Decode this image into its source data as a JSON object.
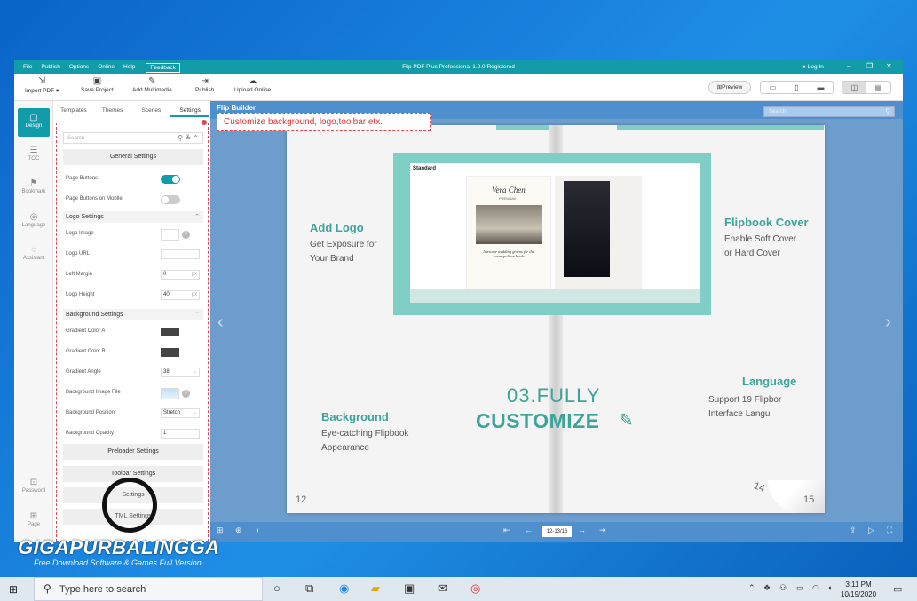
{
  "app": {
    "title": "Flip PDF Plus Professional 1.2.0 Registered",
    "menu": [
      "File",
      "Publish",
      "Options",
      "Online",
      "Help"
    ],
    "feedback": "Feedback",
    "login": "Log In"
  },
  "toolbar": {
    "import": "Import PDF ▾",
    "save": "Save Project",
    "multimedia": "Add Multimedia",
    "publish": "Publish",
    "upload": "Upload Online",
    "preview": "Preview"
  },
  "rail": {
    "design": "Design",
    "toc": "TOC",
    "bookmark": "Bookmark",
    "language": "Language",
    "assistant": "Assistant",
    "password": "Password",
    "page": "Page"
  },
  "panel": {
    "tabs": [
      "Templates",
      "Themes",
      "Scenes",
      "Settings"
    ],
    "search_placeholder": "Search",
    "general": "General Settings",
    "page_buttons": "Page Buttons",
    "page_buttons_mobile": "Page Buttons on Mobile",
    "page_buttons_on": 1,
    "page_buttons_mobile_on": 0,
    "logo_settings": "Logo Settings",
    "logo_image": "Logo Image",
    "logo_url": "Logo URL",
    "left_margin": "Left Margin",
    "left_margin_val": "0",
    "logo_height": "Logo Height",
    "logo_height_val": "40",
    "unit": "px",
    "bg_settings": "Background Settings",
    "grad_a": "Gradient Color A",
    "grad_b": "Gradient Color B",
    "grad_angle": "Gradient Angle",
    "grad_angle_val": "38",
    "bg_image": "Background Image File",
    "bg_position": "Background Position",
    "bg_position_val": "Stretch",
    "bg_opacity": "Background Opacity",
    "bg_opacity_val": "1",
    "preloader": "Preloader Settings",
    "toolbar_settings": "Toolbar Settings",
    "more1": "Settings",
    "more2": "TML Settings"
  },
  "tooltip": "Customize background, logo,toolbar etx.",
  "viewer": {
    "search_placeholder": "Search",
    "page_indicator": "12-13/16",
    "brand_partial": "Flip Builder"
  },
  "book": {
    "add_logo": "Add Logo",
    "add_logo_sub": [
      "Get Exposure for",
      "Your Brand"
    ],
    "cover": "Flipbook Cover",
    "cover_sub": [
      "Enable Soft Cover",
      "or Hard Cover"
    ],
    "background": "Background",
    "background_sub": [
      "Eye-catching Flipbook",
      "Appearance"
    ],
    "language": "Language",
    "language_sub": [
      "Support 19 Flipbor",
      "Interface Langu"
    ],
    "heading1": "03.FULLY",
    "heading2": "CUSTOMIZE",
    "page_left": "12",
    "page_right": "15",
    "page_curl": "14",
    "inner_brand": "Vera Chen",
    "inner_sub": "PREMIUM",
    "inner_caption": "Intricate wedding gowns for the cosmopolitan bride",
    "inner_logo": "Standard"
  },
  "watermark": {
    "name": "GIGAPURBALINGGA",
    "tagline": "Free Download Software & Games Full Version"
  },
  "taskbar": {
    "search": "Type here to search",
    "time": "3:11 PM",
    "date": "10/19/2020"
  },
  "colors": {
    "accent": "#129caa",
    "feature_green": "#3ea399",
    "tooltip_red": "#e0464d"
  }
}
